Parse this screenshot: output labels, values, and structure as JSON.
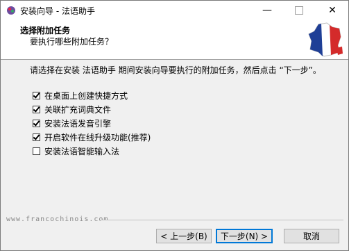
{
  "window": {
    "title": "安装向导 - 法语助手",
    "minimize_glyph": "—",
    "close_glyph": "✕"
  },
  "header": {
    "title": "选择附加任务",
    "subtitle": "要执行哪些附加任务？"
  },
  "content": {
    "intro": "请选择在安装 法语助手 期间安装向导要执行的附加任务，然后点击 “下一步”。",
    "tasks": [
      {
        "label": "在桌面上创建快捷方式",
        "checked": true
      },
      {
        "label": "关联扩充词典文件",
        "checked": true
      },
      {
        "label": "安装法语发音引擎",
        "checked": true
      },
      {
        "label": "开启软件在线升级功能(推荐)",
        "checked": true
      },
      {
        "label": "安装法语智能输入法",
        "checked": false
      }
    ]
  },
  "footer": {
    "brand": "www.francochinois.com",
    "back_label": "< 上一步(B)",
    "next_label": "下一步(N) >",
    "cancel_label": "取消"
  },
  "colors": {
    "accent": "#0078d7",
    "flag_blue": "#1f3f96",
    "flag_red": "#d42b2b"
  }
}
